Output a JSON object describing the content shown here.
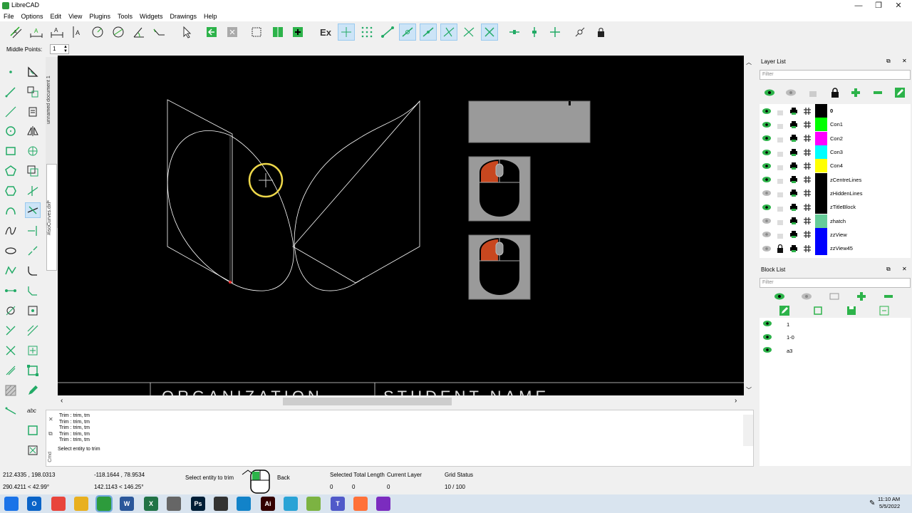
{
  "window": {
    "title": "LibreCAD"
  },
  "menu": [
    "File",
    "Options",
    "Edit",
    "View",
    "Plugins",
    "Tools",
    "Widgets",
    "Drawings",
    "Help"
  ],
  "toolbar": {
    "ex_label": "Ex"
  },
  "option_bar": {
    "label": "Middle Points:",
    "value": "1"
  },
  "doc_tabs": [
    "unnamed document 1",
    "#isoCurves.dxf*"
  ],
  "canvas": {
    "title_block": [
      "ORGANIZATION",
      "STUDENT NAME"
    ]
  },
  "command": {
    "history": [
      "Trim : trim, tm",
      "Trim : trim, tm",
      "Trim : trim, tm",
      "Trim : trim, tm",
      "Trim : trim, tm"
    ],
    "prompt": "Select entity to trim",
    "side_label": "Cmd"
  },
  "status": {
    "abs_coord": "212.4335 , 198.0313",
    "abs_polar": "290.4211 < 42.99°",
    "rel_coord": "-118.1644 , 78.9534",
    "rel_polar": "142.1143 < 146.25°",
    "left_hint": "Select entity to trim",
    "right_hint": "Back",
    "selected_total_length_label": "Selected Total Length",
    "selected_total_length_value": "0",
    "selected_count": "0",
    "current_layer_label": "Current Layer",
    "current_layer_value": "0",
    "grid_status_label": "Grid Status",
    "grid_status_value": "10 / 100"
  },
  "layer_list": {
    "title": "Layer List",
    "filter_placeholder": "Filter",
    "layers": [
      {
        "name": "0",
        "color": "#000000",
        "visible": true,
        "locked": false,
        "active": true
      },
      {
        "name": "Con1",
        "color": "#00ff00",
        "visible": true,
        "locked": false
      },
      {
        "name": "Con2",
        "color": "#ff00ff",
        "visible": true,
        "locked": false
      },
      {
        "name": "Con3",
        "color": "#00ffff",
        "visible": true,
        "locked": false
      },
      {
        "name": "Con4",
        "color": "#ffff00",
        "visible": true,
        "locked": false
      },
      {
        "name": "zCentreLines",
        "color": "#000000",
        "visible": true,
        "locked": false
      },
      {
        "name": "zHiddenLines",
        "color": "#000000",
        "visible": false,
        "locked": false
      },
      {
        "name": "zTitleBlock",
        "color": "#000000",
        "visible": true,
        "locked": false
      },
      {
        "name": "zhatch",
        "color": "#66cc99",
        "visible": false,
        "locked": false
      },
      {
        "name": "zzView",
        "color": "#0000ff",
        "visible": false,
        "locked": false
      },
      {
        "name": "zzView45",
        "color": "#0000ff",
        "visible": false,
        "locked": true
      }
    ]
  },
  "block_list": {
    "title": "Block List",
    "filter_placeholder": "Filter",
    "blocks": [
      "1",
      "1-0",
      "a3"
    ]
  },
  "taskbar": {
    "time": "11:10 AM",
    "date": "5/5/2022",
    "apps": [
      {
        "name": "windows-start",
        "label": "",
        "color": "#1a73e8"
      },
      {
        "name": "outlook",
        "label": "O",
        "color": "#0a64c8"
      },
      {
        "name": "chrome",
        "label": "",
        "color": "#e8453c"
      },
      {
        "name": "file-explorer",
        "label": "",
        "color": "#e8b020"
      },
      {
        "name": "librecad",
        "label": "",
        "color": "#2d9b3c"
      },
      {
        "name": "word",
        "label": "W",
        "color": "#2b579a"
      },
      {
        "name": "excel",
        "label": "X",
        "color": "#217346"
      },
      {
        "name": "app-gear",
        "label": "",
        "color": "#666666"
      },
      {
        "name": "photoshop",
        "label": "Ps",
        "color": "#001e36"
      },
      {
        "name": "app-circle",
        "label": "",
        "color": "#333333"
      },
      {
        "name": "edge",
        "label": "",
        "color": "#1283c9"
      },
      {
        "name": "illustrator",
        "label": "Ai",
        "color": "#330000"
      },
      {
        "name": "app-blue",
        "label": "",
        "color": "#29a3d6"
      },
      {
        "name": "app-green",
        "label": "",
        "color": "#7cb342"
      },
      {
        "name": "teams",
        "label": "T",
        "color": "#5059c9"
      },
      {
        "name": "firefox",
        "label": "",
        "color": "#ff7139"
      },
      {
        "name": "app-purple",
        "label": "",
        "color": "#7b2cbf"
      }
    ]
  }
}
